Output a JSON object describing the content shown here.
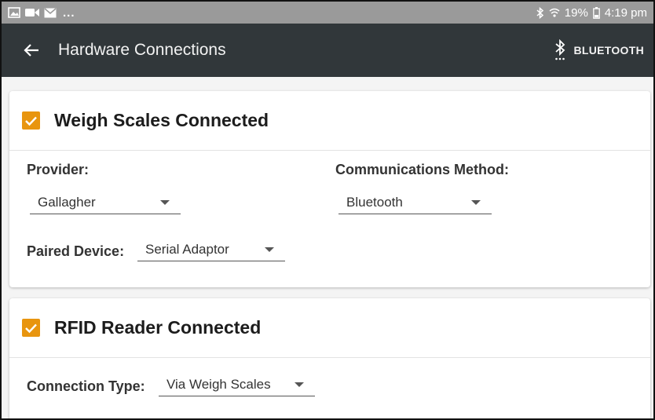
{
  "status_bar": {
    "overflow": "...",
    "battery": "19%",
    "time": "4:19 pm",
    "left_icons": [
      "image-icon",
      "video-icon",
      "mail-icon"
    ],
    "right_icons": [
      "bluetooth-icon",
      "wifi-icon",
      "battery-icon"
    ]
  },
  "app_bar": {
    "title": "Hardware Connections",
    "action_label": "BLUETOOTH",
    "action_icon": "bluetooth-searching-icon",
    "back_icon": "back-arrow-icon",
    "background": "#31373a"
  },
  "weigh_scales": {
    "title": "Weigh Scales Connected",
    "checked": true,
    "provider_label": "Provider:",
    "provider_value": "Gallagher",
    "comm_label": "Communications Method:",
    "comm_value": "Bluetooth",
    "paired_label": "Paired Device:",
    "paired_value": "Serial Adaptor"
  },
  "rfid_reader": {
    "title": "RFID Reader Connected",
    "checked": true,
    "connection_label": "Connection Type:",
    "connection_value": "Via Weigh Scales"
  },
  "colors": {
    "accent": "#e8950f",
    "status_bar": "#9a9a9a"
  }
}
